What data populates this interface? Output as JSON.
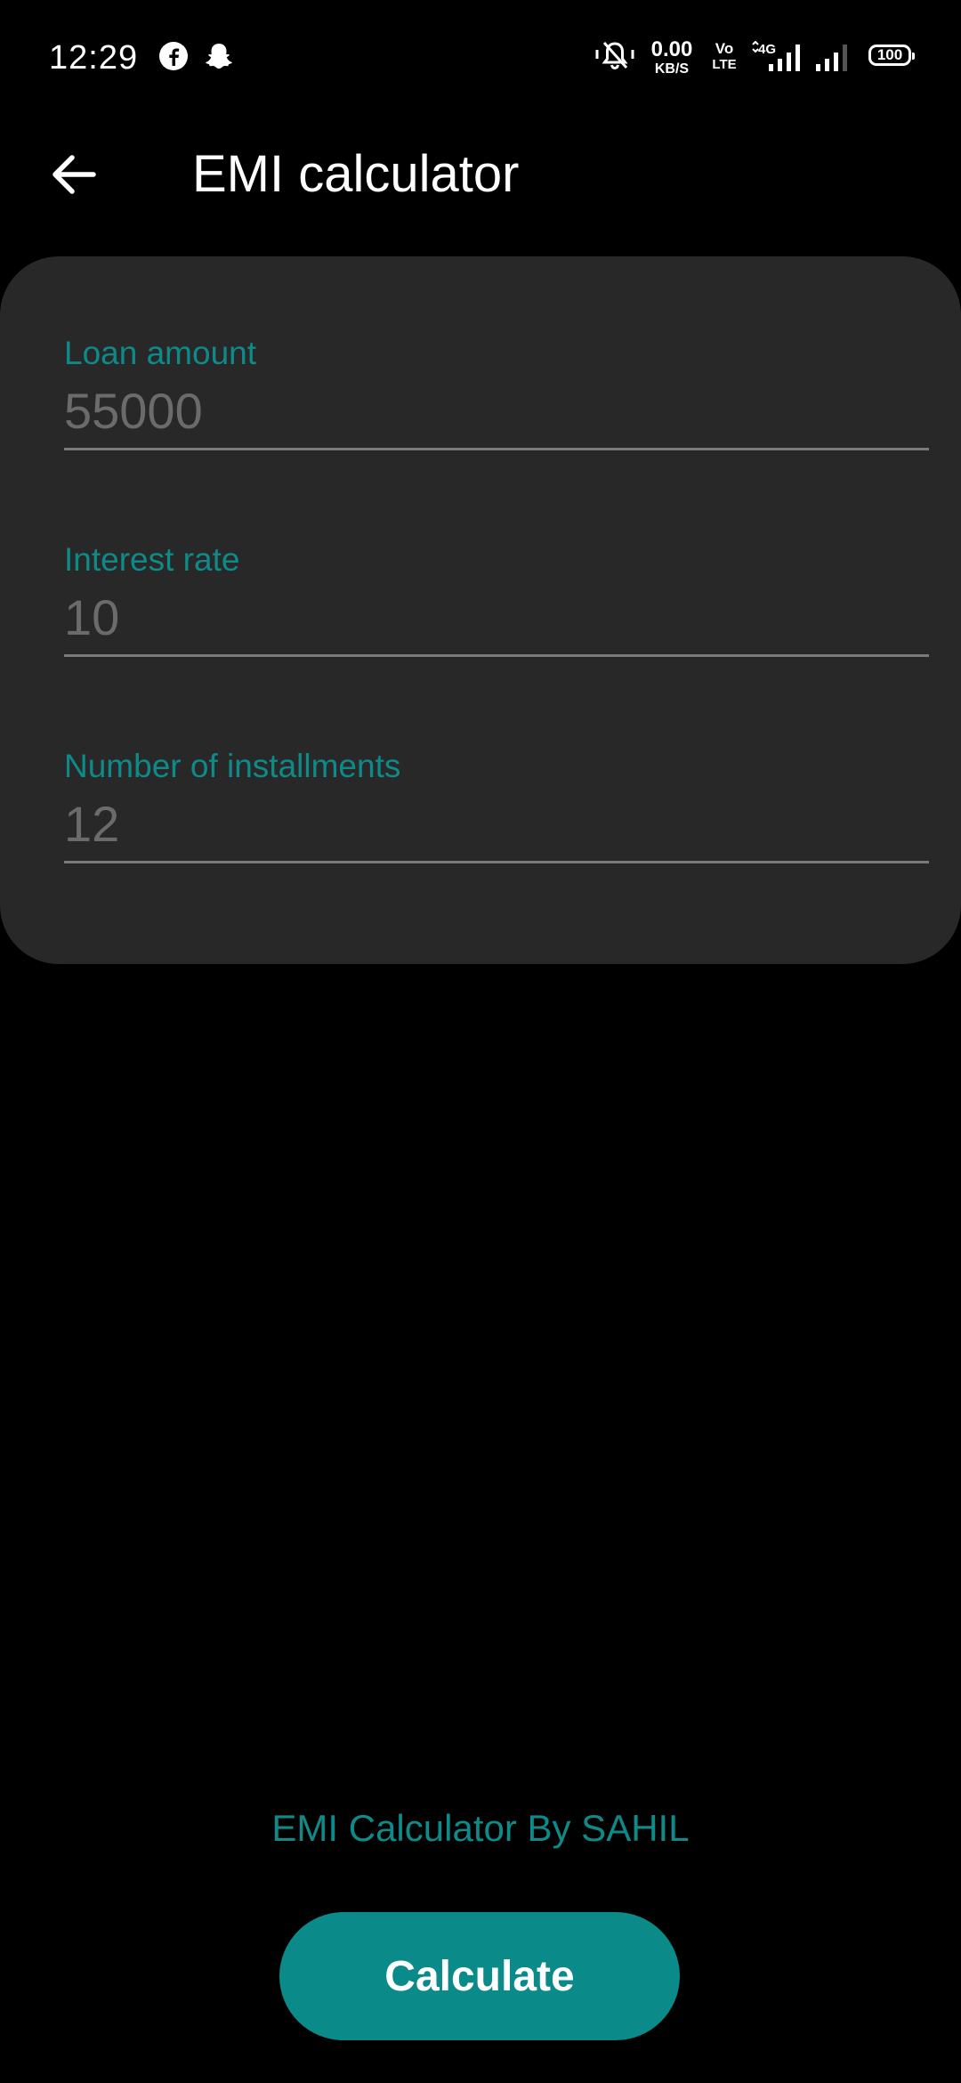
{
  "status_bar": {
    "time": "12:29",
    "app_icons": [
      "facebook-icon",
      "snapchat-icon"
    ],
    "net_speed_value": "0.00",
    "net_speed_unit": "KB/S",
    "volte_top": "Vo",
    "volte_bottom": "LTE",
    "network_type": "4G",
    "battery": "100"
  },
  "app_bar": {
    "title": "EMI calculator",
    "back_icon": "arrow-left-icon"
  },
  "form": {
    "loan_amount": {
      "label": "Loan amount",
      "placeholder": "55000",
      "value": ""
    },
    "interest_rate": {
      "label": "Interest rate",
      "placeholder": "10",
      "value": ""
    },
    "installments": {
      "label": "Number of installments",
      "placeholder": "12",
      "value": ""
    }
  },
  "footer": {
    "credit": "EMI Calculator By SAHIL",
    "calculate_label": "Calculate"
  },
  "colors": {
    "background": "#000000",
    "card": "#282828",
    "accent": "#0e8a89",
    "button": "#0a8a88",
    "placeholder": "#6b6b6b",
    "underline": "#7a7a7a"
  }
}
